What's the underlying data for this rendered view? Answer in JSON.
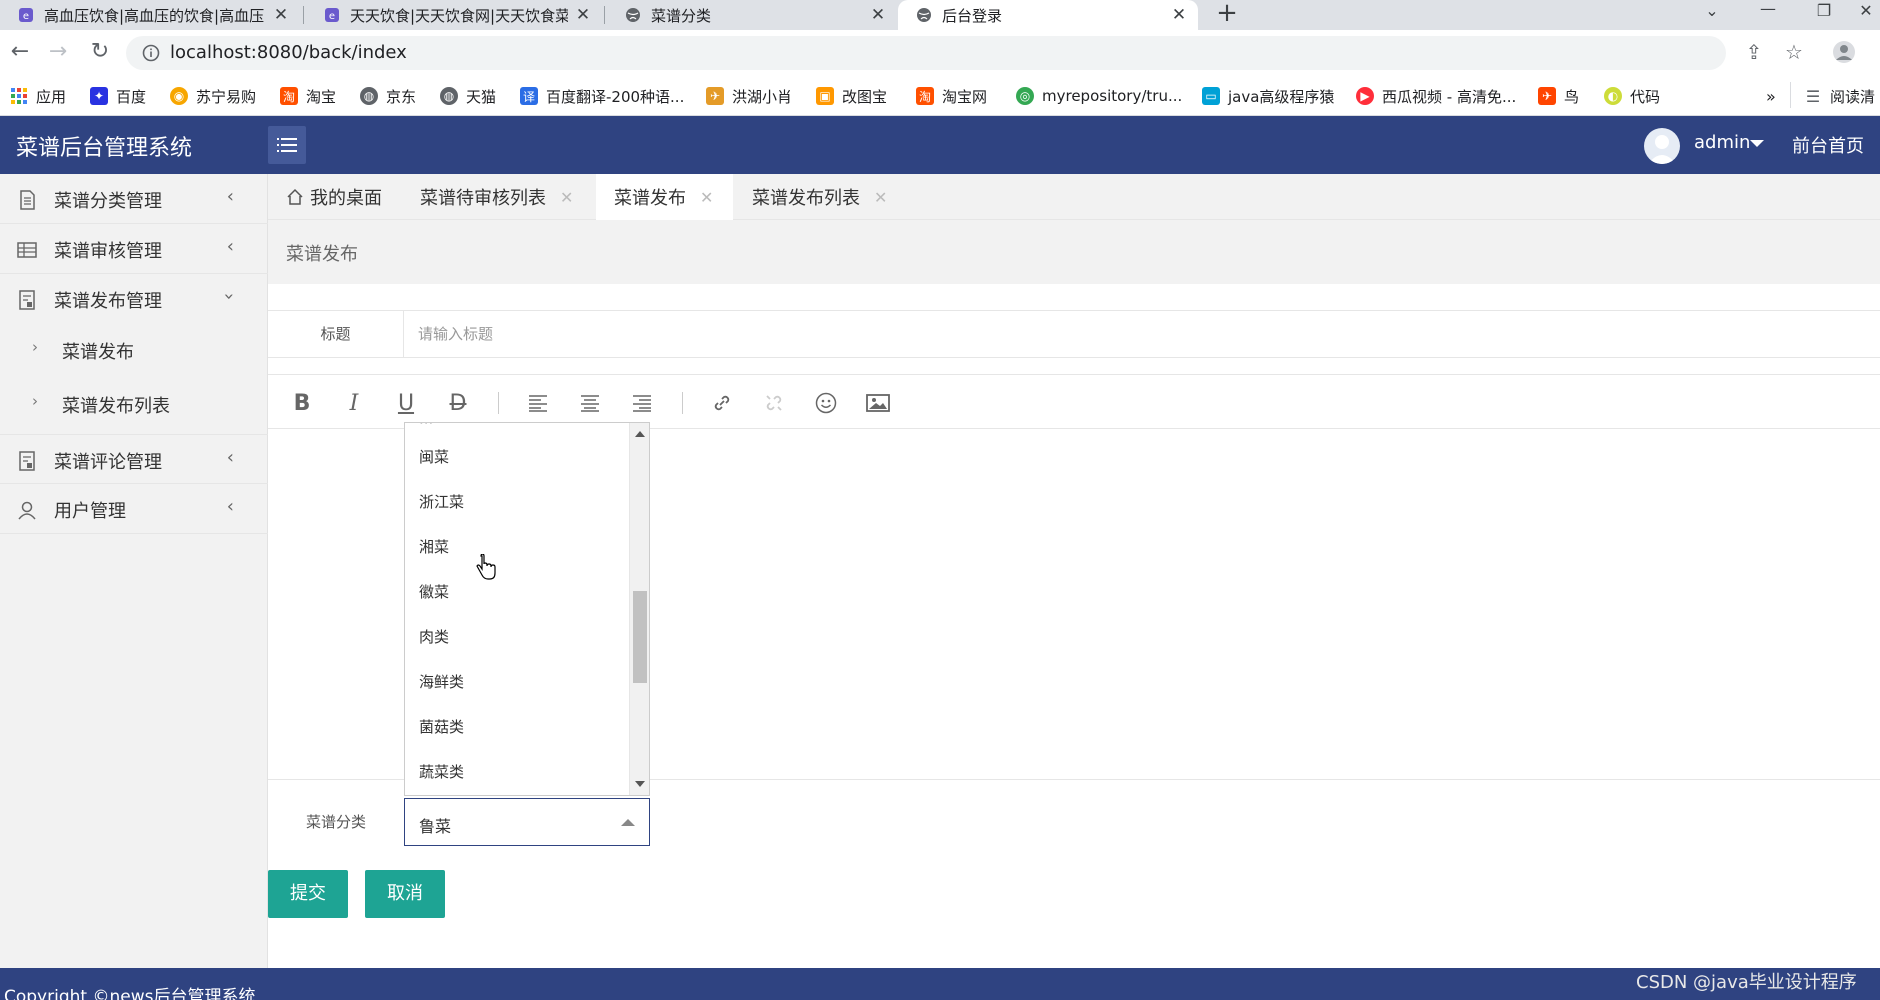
{
  "browser": {
    "tabs": [
      {
        "title": "高血压饮食|高血压的饮食|高血压",
        "icon": "site-favicon"
      },
      {
        "title": "天天饮食|天天饮食网|天天饮食菜",
        "icon": "site-favicon"
      },
      {
        "title": "菜谱分类",
        "icon": "globe-favicon"
      },
      {
        "title": "后台登录",
        "icon": "globe-favicon"
      }
    ],
    "url": "localhost:8080/back/index",
    "bookmarks": [
      {
        "label": "应用",
        "color": "#4285f4"
      },
      {
        "label": "百度",
        "color": "#2932e1"
      },
      {
        "label": "苏宁易购",
        "color": "#f7a600"
      },
      {
        "label": "淘宝",
        "color": "#ff5000"
      },
      {
        "label": "京东",
        "color": "#5f6368"
      },
      {
        "label": "天猫",
        "color": "#5f6368"
      },
      {
        "label": "百度翻译-200种语...",
        "color": "#2b6de5"
      },
      {
        "label": "洪湖小肖",
        "color": "#e49b28"
      },
      {
        "label": "改图宝",
        "color": "#ff9800"
      },
      {
        "label": "淘宝网",
        "color": "#ff5000"
      },
      {
        "label": "myrepository/tru...",
        "color": "#34a853"
      },
      {
        "label": "java高级程序猿",
        "color": "#00a1d6"
      },
      {
        "label": "西瓜视频 - 高清免...",
        "color": "#ff2e3a"
      },
      {
        "label": "鸟",
        "color": "#ff4500"
      },
      {
        "label": "代码",
        "color": "#cddc39"
      }
    ],
    "reading_mode": "阅读清"
  },
  "app": {
    "title": "菜谱后台管理系统",
    "user": "admin",
    "front_home": "前台首页"
  },
  "sidebar": {
    "items": [
      {
        "label": "菜谱分类管理",
        "icon": "document-icon",
        "state": "collapsed"
      },
      {
        "label": "菜谱审核管理",
        "icon": "table-icon",
        "state": "collapsed"
      },
      {
        "label": "菜谱发布管理",
        "icon": "form-icon",
        "state": "expanded"
      },
      {
        "label": "菜谱评论管理",
        "icon": "form-icon",
        "state": "collapsed"
      },
      {
        "label": "用户管理",
        "icon": "user-icon",
        "state": "collapsed"
      }
    ],
    "subitems": [
      "菜谱发布",
      "菜谱发布列表"
    ]
  },
  "content_tabs": [
    {
      "label": "我的桌面",
      "closable": false
    },
    {
      "label": "菜谱待审核列表",
      "closable": true
    },
    {
      "label": "菜谱发布",
      "closable": true,
      "active": true
    },
    {
      "label": "菜谱发布列表",
      "closable": true
    }
  ],
  "page": {
    "breadcrumb": "菜谱发布",
    "title_label": "标题",
    "title_placeholder": "请输入标题",
    "category_label": "菜谱分类",
    "category_value": "鲁菜",
    "category_options": [
      "闽菜",
      "浙江菜",
      "湘菜",
      "徽菜",
      "肉类",
      "海鲜类",
      "菌菇类",
      "蔬菜类"
    ],
    "submit": "提交",
    "cancel": "取消"
  },
  "editor_toolbar": [
    "bold",
    "italic",
    "underline",
    "strikethrough",
    "align-left",
    "align-center",
    "align-right",
    "link",
    "unlink",
    "emoji",
    "image"
  ],
  "footer": {
    "copyright": "Copyright ©news后台管理系统"
  },
  "watermark": "CSDN @java毕业设计程序",
  "colors": {
    "header": "#2f4381",
    "button": "#1ea494",
    "sidebar": "#f2f2f2"
  }
}
